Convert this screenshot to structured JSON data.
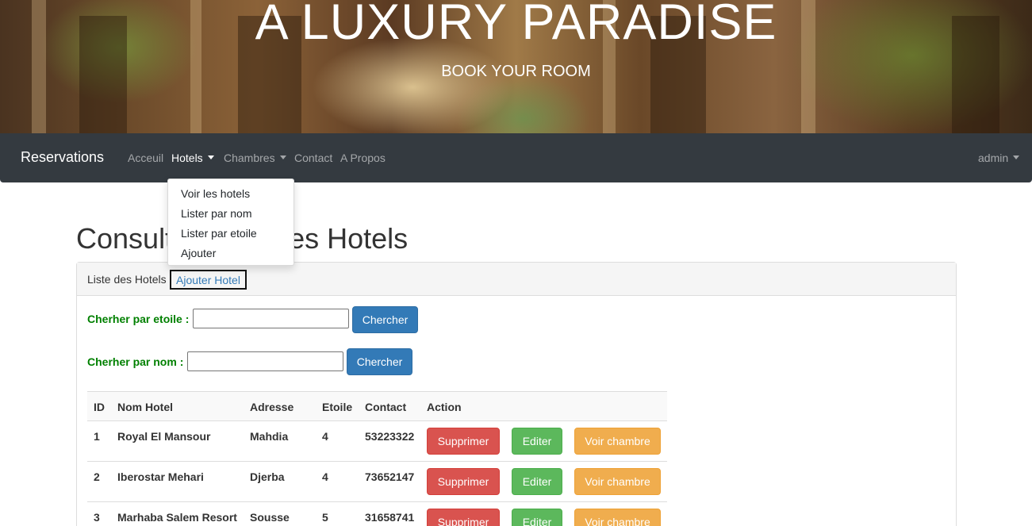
{
  "hero": {
    "title": "A LUXURY PARADISE",
    "subtitle": "BOOK YOUR ROOM"
  },
  "navbar": {
    "brand": "Reservations",
    "links": {
      "accueil": "Acceuil",
      "hotels": "Hotels",
      "chambres": "Chambres",
      "contact": "Contact",
      "apropos": "A Propos"
    },
    "user": "admin"
  },
  "dropdown": {
    "items": [
      "Voir les hotels",
      "Lister par nom",
      "Lister par etoile",
      "Ajouter"
    ]
  },
  "page": {
    "title_left": "Consult",
    "title_right": "des Hotels"
  },
  "panel": {
    "heading_text": "Liste des Hotels",
    "heading_link": "Ajouter Hotel"
  },
  "search": {
    "by_star_label": "Cherher par etoile :",
    "by_star_value": "",
    "by_name_label": "Cherher par nom :",
    "by_name_value": "",
    "button": "Chercher"
  },
  "table": {
    "headers": [
      "ID",
      "Nom Hotel",
      "Adresse",
      "Etoile",
      "Contact",
      "Action"
    ],
    "rows": [
      {
        "id": "1",
        "name": "Royal El Mansour",
        "address": "Mahdia",
        "stars": "4",
        "contact": "53223322"
      },
      {
        "id": "2",
        "name": "Iberostar Mehari",
        "address": "Djerba",
        "stars": "4",
        "contact": "73652147"
      },
      {
        "id": "3",
        "name": "Marhaba Salem Resort",
        "address": "Sousse",
        "stars": "5",
        "contact": "31658741"
      }
    ],
    "actions": {
      "delete": "Supprimer",
      "edit": "Editer",
      "rooms": "Voir chambre"
    }
  },
  "colors": {
    "navbar": "#343a40",
    "label_green": "#008000",
    "primary": "#337ab7",
    "danger": "#d9534f",
    "success": "#5cb85c",
    "warning": "#f0ad4e"
  }
}
